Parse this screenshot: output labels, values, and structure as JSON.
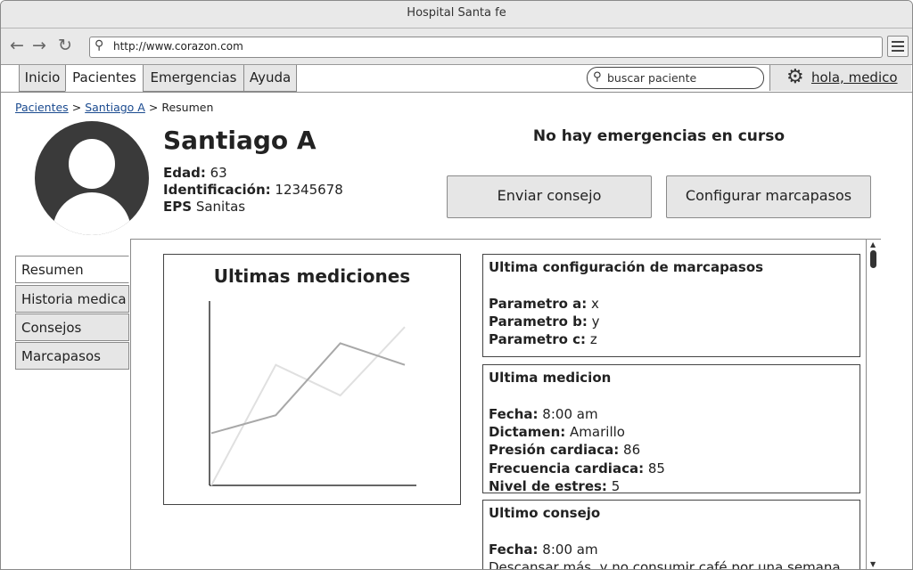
{
  "window": {
    "title": "Hospital Santa fe"
  },
  "browser": {
    "url": "http://www.corazon.com"
  },
  "nav": {
    "tabs": [
      {
        "label": "Inicio",
        "active": false
      },
      {
        "label": "Pacientes",
        "active": true
      },
      {
        "label": "Emergencias",
        "active": false
      },
      {
        "label": "Ayuda",
        "active": false
      }
    ],
    "search_placeholder": "buscar paciente",
    "user_label": "hola, medico"
  },
  "breadcrumb": {
    "items": [
      "Pacientes",
      "Santiago A"
    ],
    "current": "Resumen"
  },
  "patient": {
    "name": "Santiago A",
    "age_label": "Edad:",
    "age": "63",
    "id_label": "Identificación:",
    "id": "12345678",
    "eps_label": "EPS",
    "eps": "Sanitas"
  },
  "emergency_status": "No hay emergencias en curso",
  "actions": {
    "send_advice": "Enviar consejo",
    "configure_pacemaker": "Configurar marcapasos"
  },
  "side_tabs": [
    {
      "label": "Resumen",
      "active": true
    },
    {
      "label": "Historia medica",
      "active": false
    },
    {
      "label": "Consejos",
      "active": false
    },
    {
      "label": "Marcapasos",
      "active": false
    }
  ],
  "chart_card": {
    "title": "Ultimas mediciones"
  },
  "chart_data": {
    "type": "line",
    "title": "Ultimas mediciones",
    "x": [
      0,
      1,
      2,
      3
    ],
    "ylim": [
      0,
      100
    ],
    "series": [
      {
        "values": [
          29,
          39,
          79,
          67
        ],
        "color": "#a8a8a8"
      },
      {
        "values": [
          0,
          67,
          50,
          88
        ],
        "color": "#e0e0e0"
      }
    ]
  },
  "config_card": {
    "title": "Ultima configuración de marcapasos",
    "rows": [
      {
        "label": "Parametro a:",
        "value": "x"
      },
      {
        "label": "Parametro b:",
        "value": "y"
      },
      {
        "label": "Parametro c:",
        "value": "z"
      }
    ]
  },
  "measurement_card": {
    "title": "Ultima medicion",
    "rows": [
      {
        "label": "Fecha:",
        "value": "8:00 am"
      },
      {
        "label": "Dictamen:",
        "value": "Amarillo"
      },
      {
        "label": "Presión cardiaca:",
        "value": "86"
      },
      {
        "label": "Frecuencia cardiaca:",
        "value": "85"
      },
      {
        "label": "Nivel de estres:",
        "value": "5"
      }
    ]
  },
  "advice_card": {
    "title": "Ultimo consejo",
    "rows": [
      {
        "label": "Fecha:",
        "value": "8:00 am"
      },
      {
        "label": "",
        "value": "Descansar más, y no consumir café por una semana"
      }
    ]
  }
}
